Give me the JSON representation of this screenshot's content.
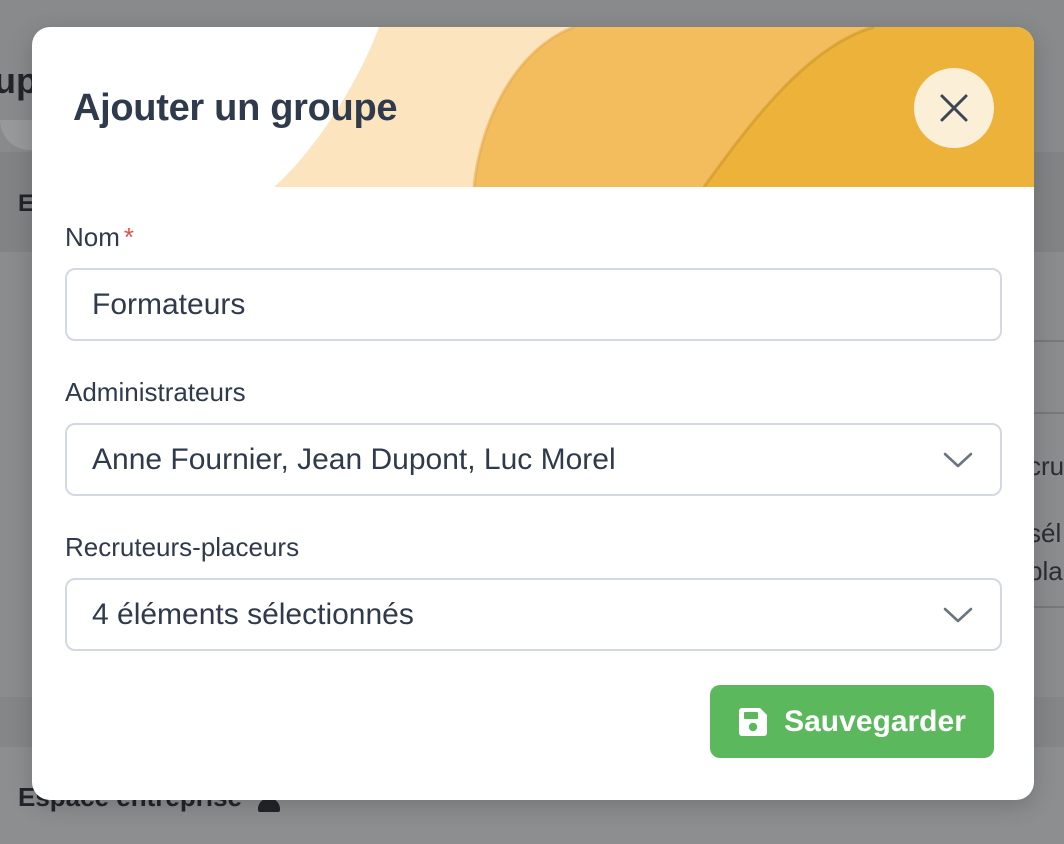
{
  "background": {
    "heading_fragment": "up",
    "tab_fragment": "E",
    "footer_label": "Espace entreprise",
    "right_texts": [
      "cru",
      "sél",
      "pla"
    ]
  },
  "modal": {
    "title": "Ajouter un groupe",
    "close_icon": "close-icon",
    "fields": {
      "nom": {
        "label": "Nom",
        "required_mark": "*",
        "value": "Formateurs"
      },
      "administrateurs": {
        "label": "Administrateurs",
        "value": "Anne Fournier, Jean Dupont, Luc Morel"
      },
      "recruteurs": {
        "label": "Recruteurs-placeurs",
        "value": "4 éléments sélectionnés"
      }
    },
    "save_button": {
      "label": "Sauvegarder",
      "icon": "floppy-disk-icon"
    }
  },
  "colors": {
    "accent_green": "#5cb85c",
    "title_text": "#2f3a4c",
    "required_red": "#d9534f",
    "header_light": "#fbe4be",
    "header_mid": "#f3bd5e",
    "header_dark": "#ecb23a"
  }
}
